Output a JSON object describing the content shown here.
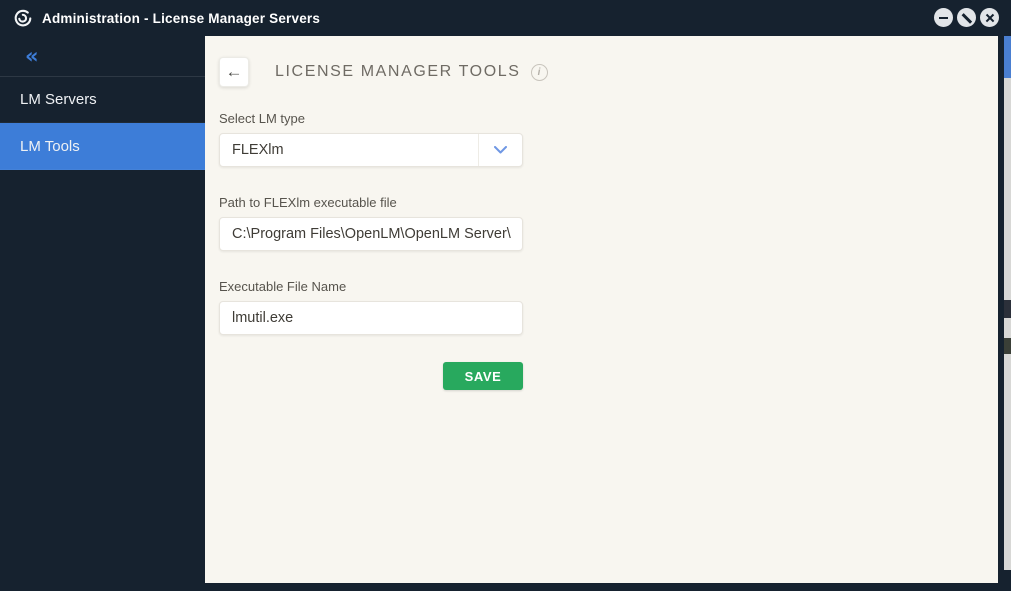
{
  "titlebar": {
    "title": "Administration - License Manager Servers"
  },
  "sidebar": {
    "items": [
      {
        "label": "LM Servers",
        "selected": false
      },
      {
        "label": "LM Tools",
        "selected": true
      }
    ]
  },
  "main": {
    "title": "LICENSE MANAGER TOOLS",
    "form": {
      "lm_type_label": "Select LM type",
      "lm_type_value": "FLEXlm",
      "path_label": "Path to FLEXlm executable file",
      "path_value": "C:\\Program Files\\OpenLM\\OpenLM Server\\",
      "exe_label": "Executable File Name",
      "exe_value": "lmutil.exe",
      "save_label": "SAVE"
    }
  },
  "icons": {
    "app_logo": "openlm-swirl-icon",
    "back": "←",
    "collapse": "«",
    "info": "i",
    "select_chevron": "chevron-down-icon",
    "minimize": "minimize-icon",
    "maximize": "maximize-blocked-icon",
    "close": "close-icon"
  },
  "colors": {
    "titlebar_bg": "#16222f",
    "sidebar_bg": "#16222f",
    "sidebar_selected": "#3d7dd8",
    "content_bg": "#f8f6f0",
    "save_button": "#28a95e",
    "accent_blue": "#3d7dd8",
    "chevron_blue": "#6f97e4"
  }
}
